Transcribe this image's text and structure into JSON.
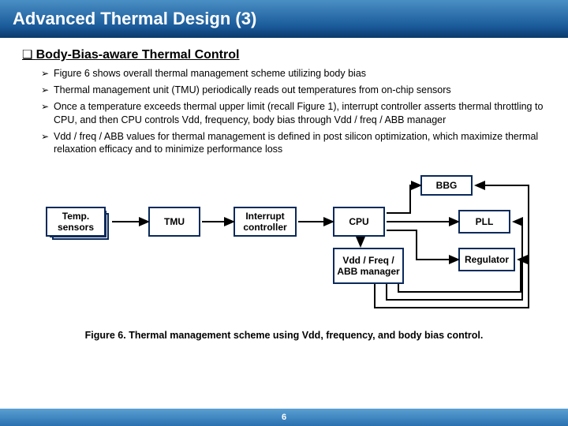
{
  "header": {
    "title": "Advanced Thermal Design (3)"
  },
  "section": {
    "heading": "Body-Bias-aware Thermal Control"
  },
  "bullets": [
    "Figure 6 shows overall thermal management scheme utilizing body bias",
    "Thermal management unit (TMU) periodically reads out temperatures from on-chip sensors",
    "Once a temperature exceeds thermal upper limit (recall Figure 1), interrupt controller asserts thermal throttling to CPU, and then CPU controls Vdd, frequency, body bias through Vdd / freq / ABB manager",
    "Vdd / freq / ABB values for thermal management is defined in post silicon optimization, which maximize thermal relaxation efficacy and to minimize performance loss"
  ],
  "diagram": {
    "boxes": {
      "temp": "Temp. sensors",
      "tmu": "TMU",
      "intc": "Interrupt controller",
      "cpu": "CPU",
      "bbg": "BBG",
      "pll": "PLL",
      "reg": "Regulator",
      "mgr": "Vdd / Freq / ABB manager"
    },
    "caption": "Figure 6. Thermal management scheme using Vdd, frequency, and body bias control."
  },
  "page": {
    "number": "6"
  }
}
